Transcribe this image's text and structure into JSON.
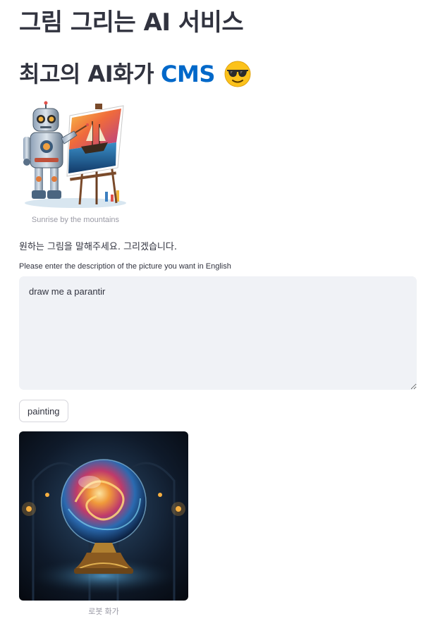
{
  "header": {
    "title": "그림 그리는 AI 서비스",
    "subtitle_prefix": "최고의 AI화가",
    "subtitle_accent": "CMS",
    "accent_color": "#0068c9"
  },
  "hero_image": {
    "icon": "robot-painter-image",
    "caption": "Sunrise by the mountains"
  },
  "prompt": {
    "instruction": "원하는 그림을 말해주세요. 그리겠습니다.",
    "label": "Please enter the description of the picture you want in English",
    "value": "draw me a parantir"
  },
  "actions": {
    "paint_label": "painting"
  },
  "result_image": {
    "icon": "crystal-orb-image",
    "caption": "로봇 화가"
  },
  "emoji": "sunglasses-face"
}
